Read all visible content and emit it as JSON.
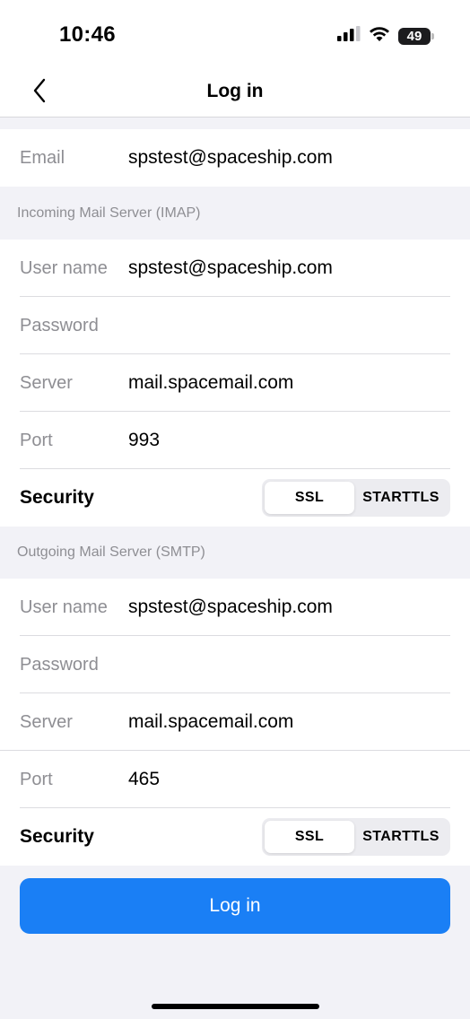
{
  "status_bar": {
    "time": "10:46",
    "battery": "49"
  },
  "nav": {
    "title": "Log in"
  },
  "email": {
    "label": "Email",
    "value": "spstest@spaceship.com"
  },
  "incoming": {
    "header": "Incoming Mail Server (IMAP)",
    "username_label": "User name",
    "username_value": "spstest@spaceship.com",
    "password_label": "Password",
    "password_value": "",
    "server_label": "Server",
    "server_value": "mail.spacemail.com",
    "port_label": "Port",
    "port_value": "993",
    "security_label": "Security",
    "security_options": [
      "SSL",
      "STARTTLS"
    ],
    "security_selected": "SSL"
  },
  "outgoing": {
    "header": "Outgoing Mail Server (SMTP)",
    "username_label": "User name",
    "username_value": "spstest@spaceship.com",
    "password_label": "Password",
    "password_value": "",
    "server_label": "Server",
    "server_value": "mail.spacemail.com",
    "port_label": "Port",
    "port_value": "465",
    "security_label": "Security",
    "security_options": [
      "SSL",
      "STARTTLS"
    ],
    "security_selected": "SSL"
  },
  "login_button": {
    "label": "Log in"
  },
  "colors": {
    "accent": "#1a7ff5",
    "background": "#f2f2f7"
  },
  "icons": [
    "signal-icon",
    "wifi-icon",
    "battery-icon",
    "chevron-left-icon"
  ]
}
